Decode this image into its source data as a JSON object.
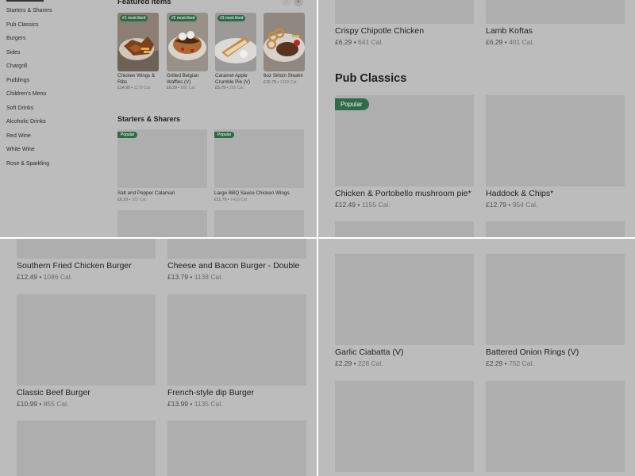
{
  "sidebar": {
    "items": [
      {
        "label": "Starters & Sharers"
      },
      {
        "label": "Pub Classics"
      },
      {
        "label": "Burgers"
      },
      {
        "label": "Sides"
      },
      {
        "label": "Chargrill"
      },
      {
        "label": "Puddings"
      },
      {
        "label": "Children's Menu"
      },
      {
        "label": "Soft Drinks"
      },
      {
        "label": "Alcoholic Drinks"
      },
      {
        "label": "Red Wine"
      },
      {
        "label": "White Wine"
      },
      {
        "label": "Rose & Sparkling"
      }
    ]
  },
  "featured": {
    "title": "Featured items",
    "prev_icon": "‹",
    "next_icon": "›",
    "items": [
      {
        "badge": "#1 most liked",
        "name": "Chicken Wings & Ribs",
        "price": "£14.99",
        "cal": "1170 Cal."
      },
      {
        "badge": "#2 most liked",
        "name": "Grilled Belgian Waffles (V)",
        "price": "£6.29",
        "cal": "895 Cal."
      },
      {
        "badge": "#3 most liked",
        "name": "Caramel Apple Crumble Pie (V)",
        "price": "£5.79",
        "cal": "395 Cal."
      },
      {
        "badge": "",
        "name": "8oz Sirloin Steak#",
        "price": "£15.79",
        "cal": "1339 Cal."
      }
    ]
  },
  "starters": {
    "title": "Starters & Sharers",
    "items": [
      {
        "badge": "Popular",
        "name": "Salt and Pepper Calamari",
        "price": "£6.29",
        "cal": "323 Cal."
      },
      {
        "badge": "Popular",
        "name": "Large BBQ Sauce Chicken Wings",
        "price": "£11.79",
        "cal": "1419 Cal."
      }
    ]
  },
  "top_right": {
    "items": [
      {
        "name": "Crispy Chipotle Chicken",
        "price": "£6.29",
        "cal": "641 Cal."
      },
      {
        "name": "Lamb Koftas",
        "price": "£6.29",
        "cal": "401 Cal."
      }
    ]
  },
  "pub_classics": {
    "title": "Pub Classics",
    "items": [
      {
        "badge": "Popular",
        "name": "Chicken & Portobello mushroom pie*",
        "price": "£12.49",
        "cal": "1155 Cal."
      },
      {
        "badge": "",
        "name": "Haddock & Chips*",
        "price": "£12.79",
        "cal": "954 Cal."
      }
    ]
  },
  "burgers": {
    "items": [
      {
        "name": "Southern Fried Chicken Burger",
        "price": "£12.49",
        "cal": "1086 Cal."
      },
      {
        "name": "Cheese and Bacon Burger - Double",
        "price": "£13.79",
        "cal": "1138 Cal."
      },
      {
        "name": "Classic Beef Burger",
        "price": "£10.99",
        "cal": "855 Cal."
      },
      {
        "name": "French-style dip Burger",
        "price": "£13.99",
        "cal": "1135 Cal."
      }
    ]
  },
  "sides": {
    "items": [
      {
        "name": "Garlic Ciabatta (V)",
        "price": "£2.29",
        "cal": "228 Cal."
      },
      {
        "name": "Battered Onion Rings (V)",
        "price": "£2.29",
        "cal": "752 Cal."
      }
    ]
  },
  "sep": " • ",
  "colors": {
    "popular_badge": "#2e6b46",
    "overlay": "#bcbcbc"
  }
}
